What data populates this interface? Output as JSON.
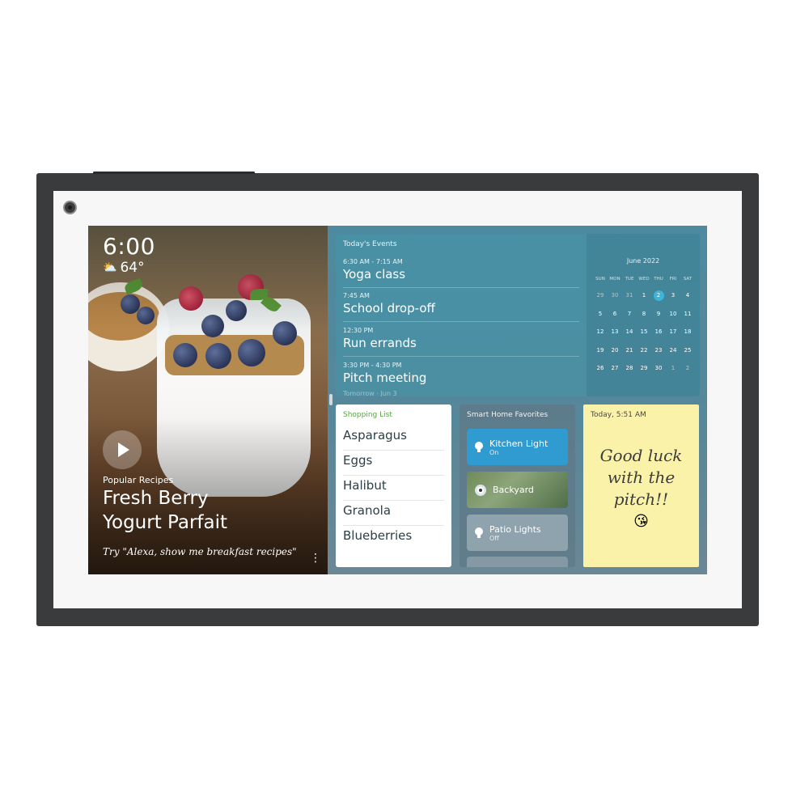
{
  "clock": {
    "time": "6:00",
    "temperature": "64°",
    "weather_icon": "partly-cloudy-icon"
  },
  "recipe": {
    "category": "Popular Recipes",
    "title_line1": "Fresh Berry",
    "title_line2": "Yogurt Parfait",
    "hint": "Try \"Alexa, show me breakfast recipes\""
  },
  "events": {
    "title": "Today's Events",
    "items": [
      {
        "time": "6:30 AM - 7:15 AM",
        "name": "Yoga class"
      },
      {
        "time": "7:45 AM",
        "name": "School drop-off"
      },
      {
        "time": "12:30 PM",
        "name": "Run errands"
      },
      {
        "time": "3:30 PM - 4:30 PM",
        "name": "Pitch meeting"
      }
    ],
    "next_label": "Tomorrow · Jun 3"
  },
  "calendar": {
    "month": "June 2022",
    "weekdays": [
      "SUN",
      "MON",
      "TUE",
      "WED",
      "THU",
      "FRI",
      "SAT"
    ],
    "weeks": [
      [
        "29",
        "30",
        "31",
        "1",
        "2",
        "3",
        "4"
      ],
      [
        "5",
        "6",
        "7",
        "8",
        "9",
        "10",
        "11"
      ],
      [
        "12",
        "13",
        "14",
        "15",
        "16",
        "17",
        "18"
      ],
      [
        "19",
        "20",
        "21",
        "22",
        "23",
        "24",
        "25"
      ],
      [
        "26",
        "27",
        "28",
        "29",
        "30",
        "1",
        "2"
      ]
    ],
    "today": "2"
  },
  "shopping": {
    "title": "Shopping List",
    "items": [
      "Asparagus",
      "Eggs",
      "Halibut",
      "Granola",
      "Blueberries"
    ]
  },
  "smart_home": {
    "title": "Smart Home Favorites",
    "devices": [
      {
        "name": "Kitchen Light",
        "state": "On",
        "icon": "light-bulb-icon"
      },
      {
        "name": "Backyard",
        "state": "",
        "icon": "camera-icon"
      },
      {
        "name": "Patio Lights",
        "state": "Off",
        "icon": "light-bulb-icon"
      }
    ]
  },
  "note": {
    "date": "Today, 5:51 AM",
    "line1": "Good luck",
    "line2": "with the",
    "line3": "pitch!!",
    "emoji": "😘"
  },
  "colors": {
    "accent": "#3bb5d8",
    "device_on": "#2f9bd0",
    "shopping_title": "#57a63e",
    "note_bg": "#fbf2a9"
  }
}
